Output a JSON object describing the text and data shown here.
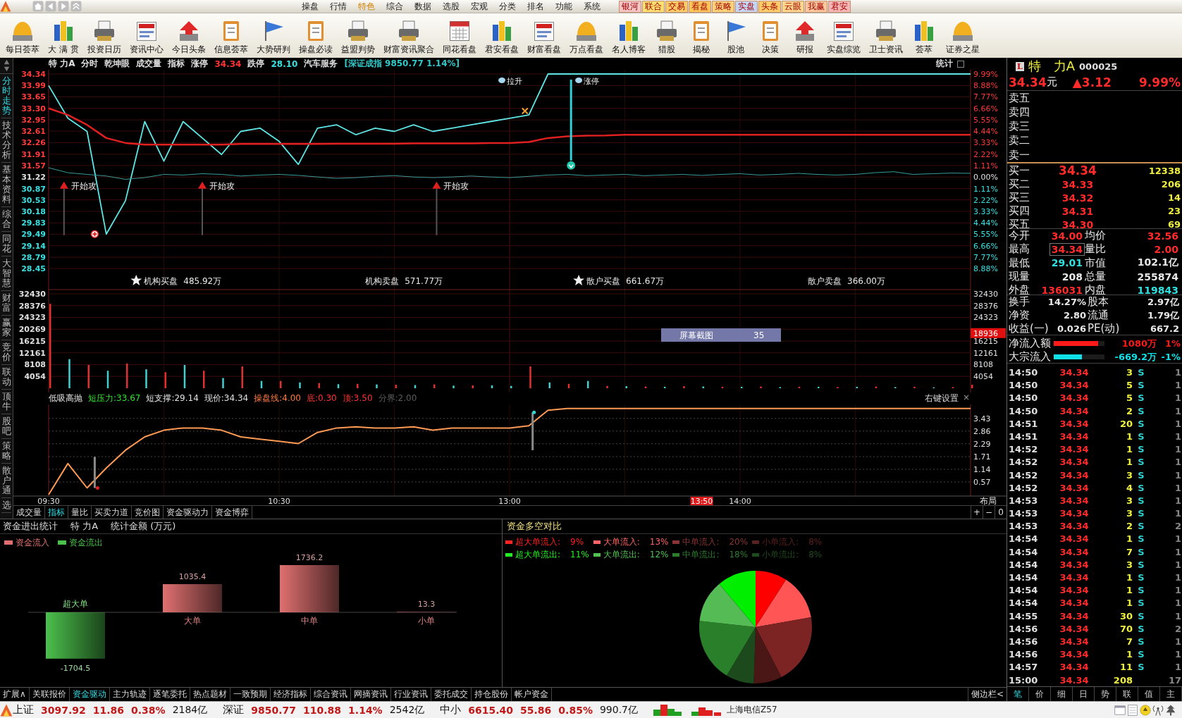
{
  "menubar": {
    "items": [
      {
        "label": "操盘",
        "selected": false
      },
      {
        "label": "行情",
        "selected": false
      },
      {
        "label": "特色",
        "selected": true
      },
      {
        "label": "综合",
        "selected": false
      },
      {
        "label": "数据",
        "selected": false
      },
      {
        "label": "选股",
        "selected": false
      },
      {
        "label": "宏观",
        "selected": false
      },
      {
        "label": "分类",
        "selected": false
      },
      {
        "label": "排名",
        "selected": false
      },
      {
        "label": "功能",
        "selected": false
      },
      {
        "label": "系统",
        "selected": false
      }
    ],
    "quick_links": [
      {
        "label": "银河",
        "color": "#f6c4c4"
      },
      {
        "label": "联合",
        "color": "#ffdf70"
      },
      {
        "label": "交易",
        "color": "#ffcc66"
      },
      {
        "label": "看盘",
        "color": "#ffc45a"
      },
      {
        "label": "策略",
        "color": "#ffd27a"
      },
      {
        "label": "实盘",
        "color": "#c6d6f6"
      },
      {
        "label": "头条",
        "color": "#ffcc6a"
      },
      {
        "label": "云眼",
        "color": "#ffd68c"
      },
      {
        "label": "我赢",
        "color": "#ffc79c"
      },
      {
        "label": "君安",
        "color": "#f6b6b6"
      }
    ]
  },
  "toolbar": [
    {
      "label": "每日荟萃"
    },
    {
      "label": "大 满 贯"
    },
    {
      "label": "投资日历"
    },
    {
      "label": "资讯中心"
    },
    {
      "label": "今日头条"
    },
    {
      "label": "信息荟萃"
    },
    {
      "label": "大势研判"
    },
    {
      "label": "操盘必读"
    },
    {
      "label": "益盟判势"
    },
    {
      "label": "财富资讯聚合"
    },
    {
      "label": "同花看盘"
    },
    {
      "label": "君安看盘"
    },
    {
      "label": "财富看盘"
    },
    {
      "label": "万点看盘"
    },
    {
      "label": "名人博客"
    },
    {
      "label": "猎股"
    },
    {
      "label": "揭秘"
    },
    {
      "label": "股池"
    },
    {
      "label": "决策"
    },
    {
      "label": "研报"
    },
    {
      "label": "实盘综览"
    },
    {
      "label": "卫士资讯"
    },
    {
      "label": "荟萃"
    },
    {
      "label": "证券之星"
    }
  ],
  "side_tabs": [
    {
      "label": "分时走势",
      "selected": true
    },
    {
      "label": "技术分析",
      "selected": false
    },
    {
      "label": "基本资料",
      "selected": false
    },
    {
      "label": "综合",
      "selected": false
    },
    {
      "label": "同花",
      "selected": false
    },
    {
      "label": "大智慧",
      "selected": false
    },
    {
      "label": "财富",
      "selected": false
    },
    {
      "label": "赢家",
      "selected": false
    },
    {
      "label": "竞价",
      "selected": false
    },
    {
      "label": "联动",
      "selected": false
    },
    {
      "label": "顶牛",
      "selected": false
    },
    {
      "label": "股吧",
      "selected": false
    },
    {
      "label": "策略",
      "selected": false
    },
    {
      "label": "散户通",
      "selected": false
    },
    {
      "label": "选",
      "selected": false
    }
  ],
  "chart_header": {
    "items": [
      {
        "text": "特 力A",
        "color": "#e0e0e0"
      },
      {
        "text": "分时",
        "color": "#e0e0e0"
      },
      {
        "text": "乾坤眼",
        "color": "#e0e0e0"
      },
      {
        "text": "成交量",
        "color": "#e0e0e0"
      },
      {
        "text": "指标",
        "color": "#e0e0e0"
      },
      {
        "text": "涨停",
        "color": "#e0e0e0"
      },
      {
        "text": "34.34",
        "color": "#ff3232"
      },
      {
        "text": "跌停",
        "color": "#e0e0e0"
      },
      {
        "text": "28.10",
        "color": "#3ae0e0"
      },
      {
        "text": "汽车服务",
        "color": "#e0e0e0"
      },
      {
        "text": "[深证成指 9850.77 1.14%]",
        "color": "#30c8c8"
      }
    ],
    "stats_button": "统计"
  },
  "price_chart": {
    "chart_data": {
      "type": "line",
      "ylim": [
        28.45,
        34.34
      ],
      "grid": true,
      "yticks": [
        {
          "value": 34.34,
          "label": "34.34"
        },
        {
          "value": 33.99,
          "label": "33.99"
        },
        {
          "value": 33.65,
          "label": "33.65"
        },
        {
          "value": 33.3,
          "label": "33.30"
        },
        {
          "value": 32.95,
          "label": "32.95"
        },
        {
          "value": 32.61,
          "label": "32.61"
        },
        {
          "value": 32.26,
          "label": "32.26"
        },
        {
          "value": 31.91,
          "label": "31.91"
        },
        {
          "value": 31.57,
          "label": "31.57"
        },
        {
          "value": 31.22,
          "label": "31.22"
        },
        {
          "value": 30.87,
          "label": "30.87"
        },
        {
          "value": 30.53,
          "label": "30.53"
        },
        {
          "value": 30.18,
          "label": "30.18"
        },
        {
          "value": 29.83,
          "label": "29.83"
        },
        {
          "value": 29.49,
          "label": "29.49"
        },
        {
          "value": 29.14,
          "label": "29.14"
        },
        {
          "value": 28.79,
          "label": "28.79"
        },
        {
          "value": 28.45,
          "label": "28.45"
        }
      ],
      "series": [
        {
          "color": "#5ee6e6",
          "values": [
            33.99,
            33.0,
            32.6,
            29.49,
            30.5,
            32.9,
            31.7,
            32.9,
            32.4,
            31.9,
            32.6,
            32.7,
            32.3,
            31.6,
            32.7,
            32.8,
            32.5,
            32.7,
            32.6,
            32.8,
            32.6,
            32.7,
            32.8,
            32.9,
            33.0,
            33.1,
            34.34,
            34.34,
            34.34,
            34.34,
            34.34,
            34.34,
            34.34,
            34.34,
            34.34,
            34.34,
            34.34,
            34.34,
            34.34,
            34.34,
            34.34,
            34.34,
            34.34,
            34.34,
            34.34,
            34.34,
            34.34,
            34.34,
            34.34
          ]
        },
        {
          "color": "#e02020",
          "values": [
            33.3,
            33.1,
            32.8,
            32.4,
            32.25,
            32.2,
            32.2,
            32.2,
            32.2,
            32.2,
            32.22,
            32.22,
            32.22,
            32.22,
            32.22,
            32.23,
            32.23,
            32.23,
            32.23,
            32.24,
            32.24,
            32.24,
            32.24,
            32.25,
            32.25,
            32.28,
            32.4,
            32.45,
            32.47,
            32.48,
            32.5,
            32.5,
            32.5,
            32.5,
            32.5,
            32.5,
            32.5,
            32.5,
            32.5,
            32.5,
            32.5,
            32.5,
            32.5,
            32.5,
            32.5,
            32.5,
            32.5,
            32.5,
            32.5
          ]
        },
        {
          "color": "#3a9a9a",
          "values": [
            31.5,
            31.35,
            31.3,
            31.25,
            31.15,
            31.2,
            31.3,
            31.28,
            31.32,
            31.3,
            31.25,
            31.28,
            31.3,
            31.27,
            31.22,
            31.18,
            31.2,
            31.24,
            31.26,
            31.22,
            31.2,
            31.22,
            31.25,
            31.22,
            31.2,
            31.24,
            31.28,
            31.3,
            31.26,
            31.28,
            31.3,
            31.26,
            31.28,
            31.3,
            31.27,
            31.3,
            31.32,
            31.28,
            31.3,
            31.33,
            31.3,
            31.28,
            31.3,
            31.35,
            31.38,
            31.3,
            31.32,
            31.34,
            31.33
          ]
        }
      ],
      "annotations": [
        "开始攻",
        "开始攻",
        "开始攻",
        "拉升",
        "涨停"
      ]
    },
    "right_ticks": [
      "9.99%",
      "8.88%",
      "7.77%",
      "6.66%",
      "5.55%",
      "4.44%",
      "3.33%",
      "2.22%",
      "1.11%",
      "0.00%",
      "1.11%",
      "2.22%",
      "3.33%",
      "4.44%",
      "5.55%",
      "6.66%",
      "7.77%",
      "8.88%"
    ],
    "flow_labels": [
      {
        "label": "机构买盘",
        "value": "485.92万",
        "starred": true
      },
      {
        "label": "机构卖盘",
        "value": "571.77万",
        "starred": false
      },
      {
        "label": "散户买盘",
        "value": "661.67万",
        "starred": true
      },
      {
        "label": "散户卖盘",
        "value": "366.00万",
        "starred": false
      }
    ]
  },
  "volume_chart": {
    "chart_data": {
      "type": "bar",
      "ylim": [
        0,
        32430
      ],
      "grid": true,
      "yticks": [
        {
          "value": 32430,
          "label": "32430"
        },
        {
          "value": 28376,
          "label": "28376"
        },
        {
          "value": 24323,
          "label": "24323"
        },
        {
          "value": 20269,
          "label": "20269"
        },
        {
          "value": 16215,
          "label": "16215"
        },
        {
          "value": 12161,
          "label": "12161"
        },
        {
          "value": 8108,
          "label": "8108"
        },
        {
          "value": 4054,
          "label": "4054"
        }
      ],
      "series": [
        {
          "color": "#e03030",
          "values": [
            29000,
            null,
            8000,
            null,
            8500,
            null,
            5500,
            null,
            6000,
            null,
            7500,
            null,
            2500,
            null,
            1800,
            null,
            1500,
            null,
            1200,
            null,
            1300,
            null,
            1000,
            null,
            null,
            7500,
            null,
            1500,
            null,
            800,
            null,
            600,
            null,
            700,
            null,
            500,
            null,
            600,
            null,
            500,
            null,
            400,
            null,
            600,
            null,
            500,
            null,
            400,
            1200
          ]
        },
        {
          "color": "#40d0d0",
          "values": [
            null,
            10000,
            null,
            6000,
            null,
            6500,
            null,
            8000,
            null,
            3500,
            null,
            2500,
            null,
            2000,
            null,
            1400,
            null,
            1300,
            null,
            1100,
            null,
            900,
            null,
            1000,
            800,
            null,
            2000,
            null,
            2500,
            null,
            700,
            null,
            500,
            null,
            600,
            null,
            500,
            null,
            400,
            null,
            500,
            null,
            500,
            null,
            400,
            null,
            300,
            null,
            null
          ]
        }
      ]
    },
    "right_ticks": [
      "32430",
      "28376",
      "24323",
      "16215",
      "12161",
      "8108",
      "4054"
    ],
    "cursor": {
      "label": "18936"
    },
    "capture_bar": {
      "label": "屏幕截图",
      "count": "35"
    }
  },
  "indicator": {
    "title": "低吸高抛",
    "params": [
      {
        "text": "短压力:33.67",
        "color": "#30e030"
      },
      {
        "text": "短支撑:29.14",
        "color": "#e0e0e0"
      },
      {
        "text": "现价:34.34",
        "color": "#e0e0e0"
      },
      {
        "text": "操盘线:4.00",
        "color": "#ff7a40"
      },
      {
        "text": "底:0.30",
        "color": "#ff3232"
      },
      {
        "text": "顶:3.50",
        "color": "#ff3232"
      },
      {
        "text": "分界:2.00",
        "color": "#5c5c5c"
      }
    ],
    "settings": "右键设置",
    "close": "×",
    "chart_data": {
      "type": "line",
      "ylim": [
        0,
        4.06
      ],
      "grid": true,
      "yticks": [
        3.43,
        2.86,
        2.29,
        1.71,
        1.14,
        0.57
      ],
      "series": [
        {
          "color": "#ff9a55",
          "values": [
            0,
            1.4,
            0.3,
            1.2,
            2.0,
            2.6,
            2.9,
            3.0,
            3.0,
            2.9,
            2.6,
            2.5,
            2.4,
            2.3,
            2.8,
            3.0,
            3.05,
            3.0,
            3.0,
            3.05,
            2.9,
            3.0,
            3.0,
            3.0,
            3.0,
            3.1,
            3.8,
            3.88,
            3.88,
            3.88,
            3.88,
            3.88,
            3.88,
            3.88,
            3.88,
            3.88,
            3.88,
            3.88,
            3.88,
            3.88,
            3.88,
            3.88,
            3.88,
            3.88,
            3.88,
            3.88,
            3.88,
            3.88,
            3.88
          ]
        }
      ]
    },
    "cursor_time": {
      "label": "13:50"
    },
    "time_axis": [
      "09:30",
      "10:30",
      "13:00",
      "14:00"
    ],
    "layout_button": "布局",
    "zoom_buttons": [
      "+",
      "−",
      "0"
    ]
  },
  "chart_tabs": [
    {
      "label": "成交量",
      "selected": false
    },
    {
      "label": "指标",
      "selected": true
    },
    {
      "label": "量比",
      "selected": false
    },
    {
      "label": "买卖力道",
      "selected": false
    },
    {
      "label": "竞价图",
      "selected": false
    },
    {
      "label": "资金驱动力",
      "selected": false
    },
    {
      "label": "资金博弈",
      "selected": false
    }
  ],
  "funds_stats": {
    "title": "资金进出统计",
    "stock": "特 力A",
    "unit": "统计金额 (万元)",
    "legend": [
      {
        "label": "资金流入",
        "color": "#e07070"
      },
      {
        "label": "资金流出",
        "color": "#4cc04c"
      }
    ],
    "chart_data": {
      "type": "bar",
      "categories": [
        "超大单",
        "大单",
        "中单",
        "小单"
      ],
      "series": [
        {
          "color": "#e07070",
          "values": [
            null,
            1035.4,
            1736.2,
            13.3
          ]
        },
        {
          "color": "#4cc04c",
          "values": [
            -1704.5,
            null,
            null,
            null
          ]
        }
      ],
      "data_labels": true
    }
  },
  "funds_pie": {
    "title": "资金多空对比",
    "legend": [
      {
        "label": "超大单流入:",
        "value": "9%",
        "color": "#ff2020"
      },
      {
        "label": "大单流入:",
        "value": "13%",
        "color": "#ff6464"
      },
      {
        "label": "中单流入:",
        "value": "20%",
        "color": "#8a3434"
      },
      {
        "label": "小单流入:",
        "value": "8%",
        "color": "#5a2020"
      },
      {
        "label": "超大单流出:",
        "value": "11%",
        "color": "#20f020"
      },
      {
        "label": "大单流出:",
        "value": "12%",
        "color": "#52c052"
      },
      {
        "label": "中单流出:",
        "value": "18%",
        "color": "#2c7c2c"
      },
      {
        "label": "小单流出:",
        "value": "8%",
        "color": "#1e4a1e"
      }
    ],
    "chart_data": {
      "type": "pie",
      "values": [
        9,
        13,
        20,
        8,
        8,
        18,
        12,
        11
      ],
      "colors": [
        "#ff0000",
        "#ff5555",
        "#7c2424",
        "#4a1616",
        "#1c4a1c",
        "#2a802a",
        "#55bb55",
        "#00ee00"
      ]
    }
  },
  "bottom_tabs": [
    {
      "label": "扩展∧",
      "selected": false
    },
    {
      "label": "关联报价",
      "selected": false
    },
    {
      "label": "资金驱动",
      "selected": true
    },
    {
      "label": "主力轨迹",
      "selected": false
    },
    {
      "label": "逐笔委托",
      "selected": false
    },
    {
      "label": "热点题材",
      "selected": false
    },
    {
      "label": "一致预期",
      "selected": false
    },
    {
      "label": "经济指标",
      "selected": false
    },
    {
      "label": "综合资讯",
      "selected": false
    },
    {
      "label": "网摘资讯",
      "selected": false
    },
    {
      "label": "行业资讯",
      "selected": false
    },
    {
      "label": "委托成交",
      "selected": false
    },
    {
      "label": "持仓股份",
      "selected": false
    },
    {
      "label": "帐户资金",
      "selected": false
    }
  ],
  "sidebar_toggle": "侧边栏<",
  "quote": {
    "badge": "L",
    "name": "特　力A",
    "code": "000025",
    "price": "34.34",
    "unit": "元",
    "change": "▲3.12",
    "change_pct": "9.99%",
    "asks": [
      {
        "label": "卖五"
      },
      {
        "label": "卖四"
      },
      {
        "label": "卖三"
      },
      {
        "label": "卖二"
      },
      {
        "label": "卖一"
      }
    ],
    "bids": [
      {
        "label": "买一",
        "price": "34.34",
        "volume": "12338"
      },
      {
        "label": "买二",
        "price": "34.33",
        "volume": "206"
      },
      {
        "label": "买三",
        "price": "34.32",
        "volume": "14"
      },
      {
        "label": "买四",
        "price": "34.31",
        "volume": "23"
      },
      {
        "label": "买五",
        "price": "34.30",
        "volume": "69"
      }
    ],
    "stats": [
      {
        "label": "今开",
        "value": "34.00",
        "color": "#ff2a2a",
        "boxed": false
      },
      {
        "label": "均价",
        "value": "32.56",
        "color": "#ff2a2a",
        "boxed": false
      },
      {
        "label": "最高",
        "value": "34.34",
        "color": "#ff2a2a",
        "boxed": true
      },
      {
        "label": "量比",
        "value": "2.00",
        "color": "#ff2a2a",
        "boxed": false
      },
      {
        "label": "最低",
        "value": "29.01",
        "color": "#30e0e0",
        "boxed": false
      },
      {
        "label": "市值",
        "value": "102.1亿",
        "color": "#e8e8e8",
        "boxed": false
      },
      {
        "label": "现量",
        "value": "208",
        "color": "#e8e8e8",
        "boxed": false
      },
      {
        "label": "总量",
        "value": "255874",
        "color": "#e8e8e8",
        "boxed": false
      },
      {
        "label": "外盘",
        "value": "136031",
        "color": "#ff2a2a",
        "boxed": false
      },
      {
        "label": "内盘",
        "value": "119843",
        "color": "#30e0e0",
        "boxed": false
      }
    ],
    "stats2": [
      {
        "label": "换手",
        "value": "14.27%"
      },
      {
        "label": "股本",
        "value": "2.97亿"
      },
      {
        "label": "净资",
        "value": "2.80"
      },
      {
        "label": "流通",
        "value": "1.79亿"
      },
      {
        "label": "收益(一)",
        "value": "0.026"
      },
      {
        "label": "PE(动)",
        "value": "667.2"
      }
    ],
    "flows": [
      {
        "label": "净流入额",
        "level": 0.88,
        "color": "#ff1a1a",
        "amount": "1080万",
        "pct": "1%"
      },
      {
        "label": "大宗流入",
        "level": 0.55,
        "color": "#10e0e8",
        "amount": "-669.2万",
        "pct": "-1%"
      }
    ],
    "ticks": [
      {
        "time": "14:50",
        "price": "34.34",
        "volume": "3",
        "side": "S",
        "count": "1"
      },
      {
        "time": "14:50",
        "price": "34.34",
        "volume": "5",
        "side": "S",
        "count": "1"
      },
      {
        "time": "14:50",
        "price": "34.34",
        "volume": "5",
        "side": "S",
        "count": "1"
      },
      {
        "time": "14:50",
        "price": "34.34",
        "volume": "2",
        "side": "S",
        "count": "1"
      },
      {
        "time": "14:51",
        "price": "34.34",
        "volume": "20",
        "side": "S",
        "count": "1"
      },
      {
        "time": "14:51",
        "price": "34.34",
        "volume": "1",
        "side": "S",
        "count": "1"
      },
      {
        "time": "14:52",
        "price": "34.34",
        "volume": "1",
        "side": "S",
        "count": "1"
      },
      {
        "time": "14:52",
        "price": "34.34",
        "volume": "1",
        "side": "S",
        "count": "1"
      },
      {
        "time": "14:52",
        "price": "34.34",
        "volume": "3",
        "side": "S",
        "count": "1"
      },
      {
        "time": "14:52",
        "price": "34.34",
        "volume": "4",
        "side": "S",
        "count": "1"
      },
      {
        "time": "14:53",
        "price": "34.34",
        "volume": "3",
        "side": "S",
        "count": "1"
      },
      {
        "time": "14:53",
        "price": "34.34",
        "volume": "3",
        "side": "S",
        "count": "1"
      },
      {
        "time": "14:53",
        "price": "34.34",
        "volume": "2",
        "side": "S",
        "count": "2"
      },
      {
        "time": "14:54",
        "price": "34.34",
        "volume": "1",
        "side": "S",
        "count": "1"
      },
      {
        "time": "14:54",
        "price": "34.34",
        "volume": "7",
        "side": "S",
        "count": "1"
      },
      {
        "time": "14:54",
        "price": "34.34",
        "volume": "3",
        "side": "S",
        "count": "1"
      },
      {
        "time": "14:54",
        "price": "34.34",
        "volume": "1",
        "side": "S",
        "count": "1"
      },
      {
        "time": "14:54",
        "price": "34.34",
        "volume": "1",
        "side": "S",
        "count": "1"
      },
      {
        "time": "14:54",
        "price": "34.34",
        "volume": "1",
        "side": "S",
        "count": "1"
      },
      {
        "time": "14:55",
        "price": "34.34",
        "volume": "30",
        "side": "S",
        "count": "1"
      },
      {
        "time": "14:56",
        "price": "34.34",
        "volume": "70",
        "side": "S",
        "count": "2"
      },
      {
        "time": "14:56",
        "price": "34.34",
        "volume": "7",
        "side": "S",
        "count": "1"
      },
      {
        "time": "14:56",
        "price": "34.34",
        "volume": "1",
        "side": "S",
        "count": "1"
      },
      {
        "time": "14:57",
        "price": "34.34",
        "volume": "11",
        "side": "S",
        "count": "1"
      },
      {
        "time": "15:00",
        "price": "34.34",
        "volume": "208",
        "count": "17"
      }
    ]
  },
  "detail_tabs": [
    {
      "label": "笔",
      "selected": true
    },
    {
      "label": "价",
      "selected": false
    },
    {
      "label": "细",
      "selected": false
    },
    {
      "label": "日",
      "selected": false
    },
    {
      "label": "势",
      "selected": false
    },
    {
      "label": "联",
      "selected": false
    },
    {
      "label": "值",
      "selected": false
    },
    {
      "label": "主",
      "selected": false
    }
  ],
  "status_bar": {
    "indices": [
      {
        "name": "上证",
        "value": "3097.92",
        "change": "11.86",
        "pct": "0.38%",
        "amount": "2184亿"
      },
      {
        "name": "深证",
        "value": "9850.77",
        "change": "110.88",
        "pct": "1.14%",
        "amount": "2542亿"
      },
      {
        "name": "中小",
        "value": "6615.40",
        "change": "55.86",
        "pct": "0.85%",
        "amount": "990.7亿"
      }
    ],
    "network": "上海电信Z57"
  }
}
